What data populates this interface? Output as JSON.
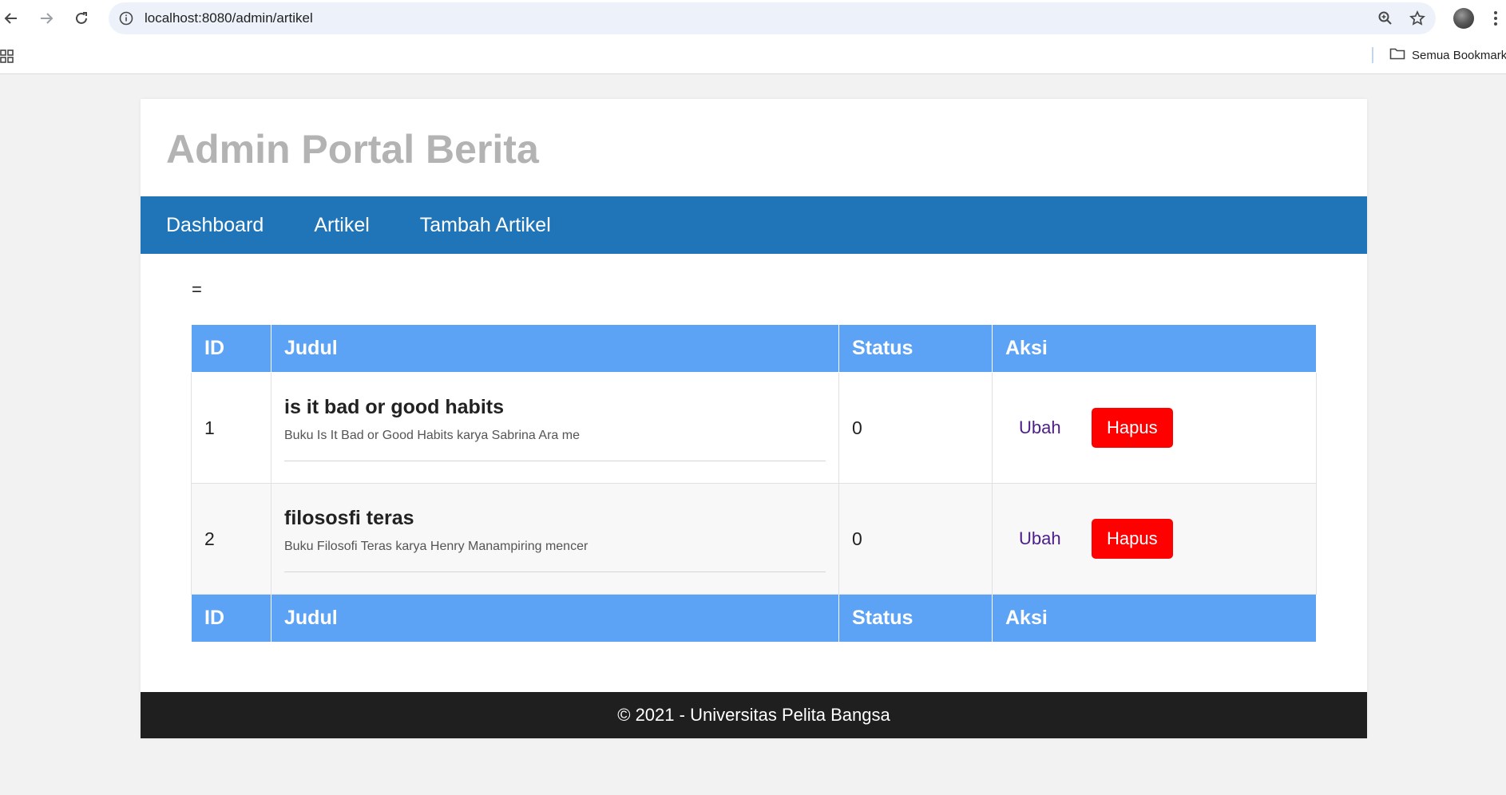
{
  "browser": {
    "url": "localhost:8080/admin/artikel",
    "bookmarks_label": "Semua Bookmark"
  },
  "site": {
    "title": "Admin Portal Berita",
    "nav": [
      {
        "label": "Dashboard"
      },
      {
        "label": "Artikel"
      },
      {
        "label": "Tambah Artikel"
      }
    ],
    "stray_text": "=",
    "table": {
      "headers": [
        "ID",
        "Judul",
        "Status",
        "Aksi"
      ],
      "rows": [
        {
          "id": "1",
          "title": "is it bad or good habits",
          "description": "Buku Is It Bad or Good Habits karya Sabrina Ara me",
          "status": "0",
          "edit_label": "Ubah",
          "delete_label": "Hapus"
        },
        {
          "id": "2",
          "title": "filososfi teras",
          "description": "Buku Filosofi Teras karya Henry Manampiring mencer",
          "status": "0",
          "edit_label": "Ubah",
          "delete_label": "Hapus"
        }
      ],
      "footer_headers": [
        "ID",
        "Judul",
        "Status",
        "Aksi"
      ]
    },
    "footer_text": "© 2021 - Universitas Pelita Bangsa"
  },
  "colors": {
    "navbar": "#2075b8",
    "table_header": "#5ca3f6",
    "delete_button": "#ff0000",
    "footer": "#1f1f1f",
    "title": "#b3b3b3"
  },
  "icons": [
    "back-arrow-icon",
    "forward-arrow-icon",
    "reload-icon",
    "site-info-icon",
    "zoom-icon",
    "star-icon",
    "profile-avatar",
    "more-menu-icon",
    "apps-grid-icon",
    "folder-icon"
  ]
}
